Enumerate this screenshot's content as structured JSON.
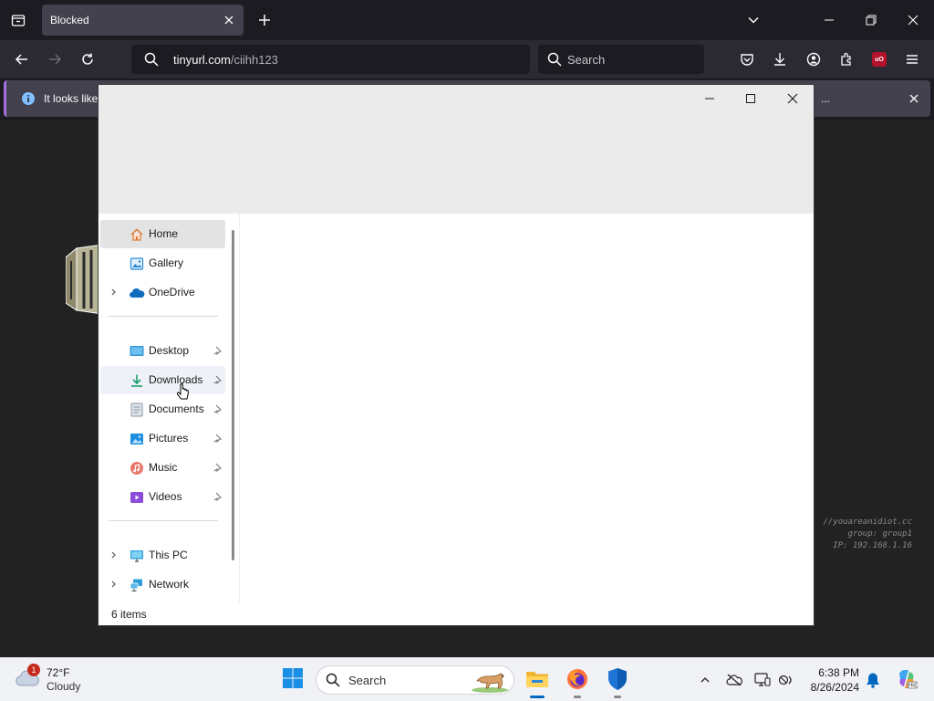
{
  "browser": {
    "tab": {
      "title": "Blocked"
    },
    "url": {
      "host": "tinyurl.com",
      "path": "/ciihh123"
    },
    "search": {
      "placeholder": "Search"
    },
    "notice": {
      "text": "It looks like",
      "ellipsis": "..."
    }
  },
  "page": {
    "info_lines": [
      "//youareanidiot.cc",
      "group: group1",
      "IP: 192.168.1.16"
    ]
  },
  "explorer": {
    "nav": [
      {
        "label": "Home",
        "icon": "home-icon"
      },
      {
        "label": "Gallery",
        "icon": "gallery-icon"
      },
      {
        "label": "OneDrive",
        "icon": "onedrive-icon"
      },
      {
        "label": "Desktop",
        "icon": "desktop-icon"
      },
      {
        "label": "Downloads",
        "icon": "downloads-icon"
      },
      {
        "label": "Documents",
        "icon": "documents-icon"
      },
      {
        "label": "Pictures",
        "icon": "pictures-icon"
      },
      {
        "label": "Music",
        "icon": "music-icon"
      },
      {
        "label": "Videos",
        "icon": "videos-icon"
      },
      {
        "label": "This PC",
        "icon": "this-pc-icon"
      },
      {
        "label": "Network",
        "icon": "network-icon"
      }
    ],
    "status": "6 items"
  },
  "taskbar": {
    "weather": {
      "temp": "72°F",
      "condition": "Cloudy",
      "badge": "1"
    },
    "search": {
      "label": "Search"
    },
    "clock": {
      "time": "6:38 PM",
      "date": "8/26/2024"
    }
  },
  "colors": {
    "accent": "#0067c0",
    "notice_border": "#a470e0",
    "ublock": "#b3122a"
  }
}
